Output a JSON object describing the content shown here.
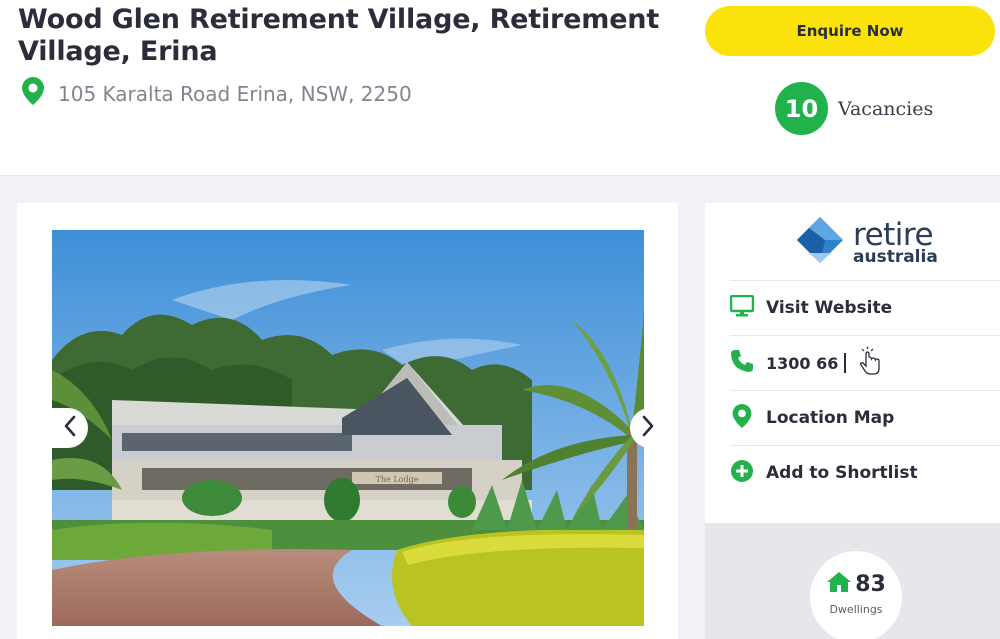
{
  "header": {
    "title": "Wood Glen Retirement Village, Retirement Village, Erina",
    "address": "105 Karalta Road Erina, NSW, 2250",
    "enquire_label": "Enquire Now",
    "vacancies_count": "10",
    "vacancies_label": "Vacancies"
  },
  "gallery": {
    "prev_icon": "chevron-left-icon",
    "next_icon": "chevron-right-icon",
    "sign_text": "The Lodge"
  },
  "provider": {
    "logo_word1": "retire",
    "logo_word2": "australia"
  },
  "actions": [
    {
      "label": "Visit Website",
      "icon": "monitor-icon"
    },
    {
      "label": "1300 66",
      "icon": "phone-icon"
    },
    {
      "label": "Location Map",
      "icon": "map-pin-icon"
    },
    {
      "label": "Add to Shortlist",
      "icon": "plus-circle-icon"
    }
  ],
  "stats": {
    "dwellings_count": "83",
    "dwellings_label": "Dwellings"
  },
  "colors": {
    "accent_green": "#22b24c",
    "button_yellow": "#fbe20a",
    "text_dark": "#2b2d3a",
    "logo_blue": "#2d82c9"
  }
}
